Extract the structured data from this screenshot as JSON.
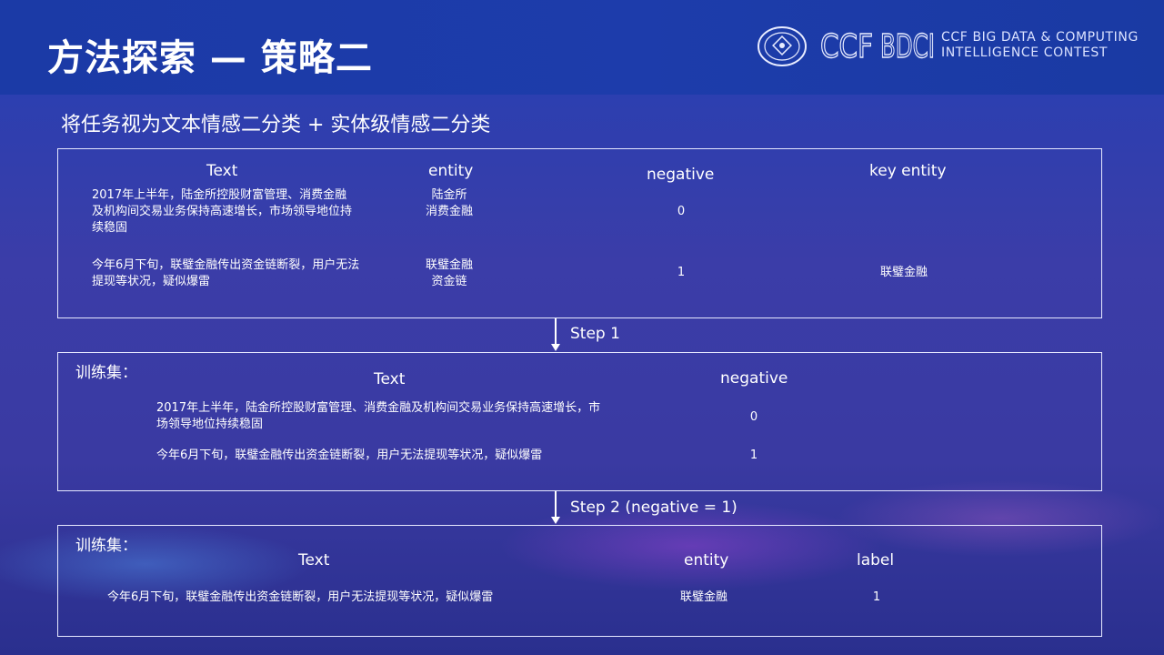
{
  "header": {
    "title": "方法探索 — 策略二",
    "logo_ccf": "CCF",
    "logo_bdci": "BDCI",
    "logo_line1": "CCF BIG DATA & COMPUTING",
    "logo_line2": "INTELLIGENCE CONTEST"
  },
  "subtitle": "将任务视为文本情感二分类 + 实体级情感二分类",
  "panel1": {
    "headers": [
      "Text",
      "entity",
      "negative",
      "key entity"
    ],
    "rows": [
      {
        "text": "2017年上半年，陆金所控股财富管理、消费金融及机构间交易业务保持高速增长，市场领导地位持续稳固",
        "entity_line1": "陆金所",
        "entity_line2": "消费金融",
        "negative": "0",
        "key_entity": ""
      },
      {
        "text": "今年6月下旬，联璧金融传出资金链断裂，用户无法提现等状况，疑似爆雷",
        "entity_line1": "联璧金融",
        "entity_line2": "资金链",
        "negative": "1",
        "key_entity": "联璧金融"
      }
    ]
  },
  "step1": "Step 1",
  "panel2": {
    "label": "训练集：",
    "headers": [
      "Text",
      "negative"
    ],
    "rows": [
      {
        "text": "2017年上半年，陆金所控股财富管理、消费金融及机构间交易业务保持高速增长，市场领导地位持续稳固",
        "negative": "0"
      },
      {
        "text": "今年6月下旬，联璧金融传出资金链断裂，用户无法提现等状况，疑似爆雷",
        "negative": "1"
      }
    ]
  },
  "step2": "Step 2  (negative = 1)",
  "panel3": {
    "label": "训练集：",
    "headers": [
      "Text",
      "entity",
      "label"
    ],
    "rows": [
      {
        "text": "今年6月下旬，联璧金融传出资金链断裂，用户无法提现等状况，疑似爆雷",
        "entity": "联璧金融",
        "label": "1"
      }
    ]
  },
  "colors": {
    "background": "#3a3ca6",
    "header_band": "#1c3ba8",
    "text": "#ffffff",
    "panel_border": "#e6e8ff"
  }
}
